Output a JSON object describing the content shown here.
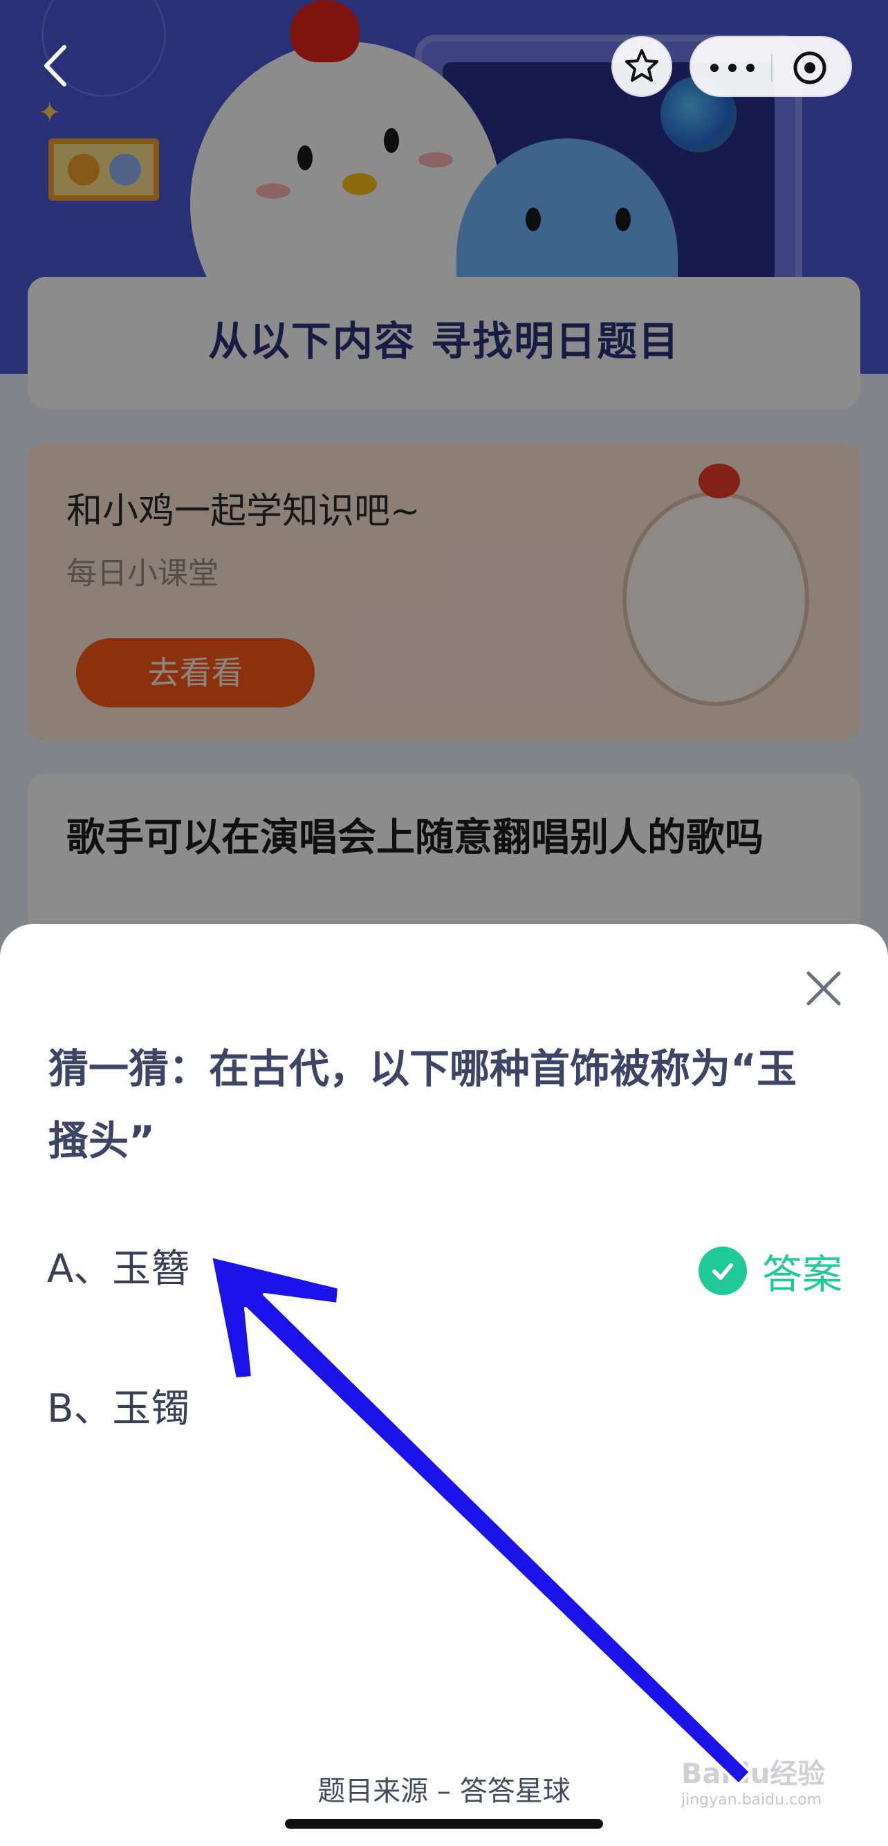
{
  "background": {
    "banner_title": "从以下内容 寻找明日题目",
    "promo": {
      "title": "和小鸡一起学知识吧~",
      "subtitle": "每日小课堂",
      "button": "去看看"
    },
    "question_card": "歌手可以在演唱会上随意翻唱别人的歌吗"
  },
  "nav": {
    "icons": [
      "back-arrow-icon",
      "star-icon",
      "more-icon",
      "target-close-icon"
    ]
  },
  "sheet": {
    "question": "猜一猜：在古代，以下哪种首饰被称为“玉搔头”",
    "options": [
      {
        "label": "A、玉簪",
        "is_answer": true
      },
      {
        "label": "B、玉镯",
        "is_answer": false
      }
    ],
    "answer_label": "答案",
    "source": "题目来源 – 答答星球"
  },
  "watermark": {
    "brand": "Baidu经验",
    "url": "jingyan.baidu.com"
  },
  "colors": {
    "accent_green": "#20c997",
    "question_text": "#3d4466",
    "annotation_arrow": "#1a12e8"
  }
}
